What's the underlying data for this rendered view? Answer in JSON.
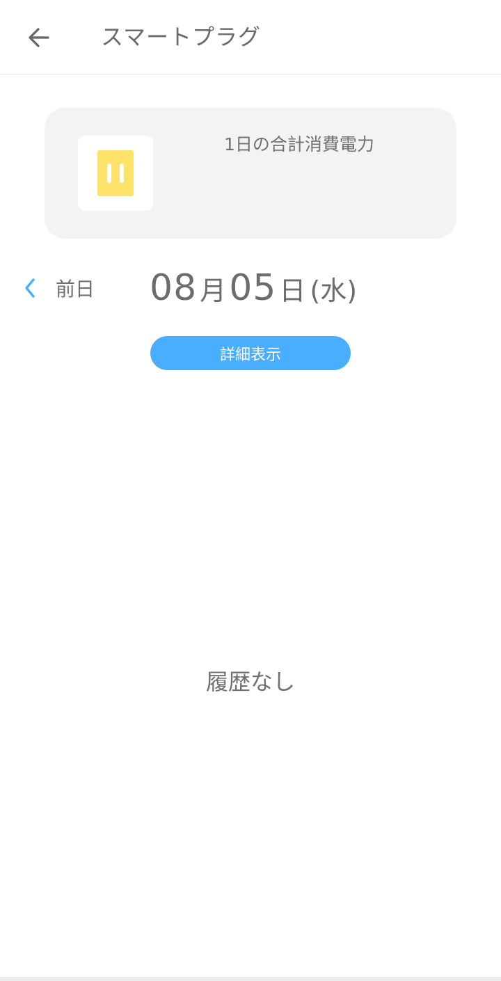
{
  "header": {
    "back_icon": "arrow-left-icon",
    "title": "スマートプラグ"
  },
  "summary_card": {
    "device_icon": "smart-plug-icon",
    "device_icon_color": "#fde26a",
    "label": "1日の合計消費電力"
  },
  "date_nav": {
    "prev_icon": "chevron-left-icon",
    "prev_label": "前日",
    "month": "08",
    "month_unit": "月",
    "day": "05",
    "day_unit": "日",
    "weekday": "(水)",
    "accent_color": "#4aaeff"
  },
  "detail_button": {
    "label": "詳細表示",
    "color": "#4aaeff"
  },
  "history": {
    "empty_text": "履歴なし"
  }
}
